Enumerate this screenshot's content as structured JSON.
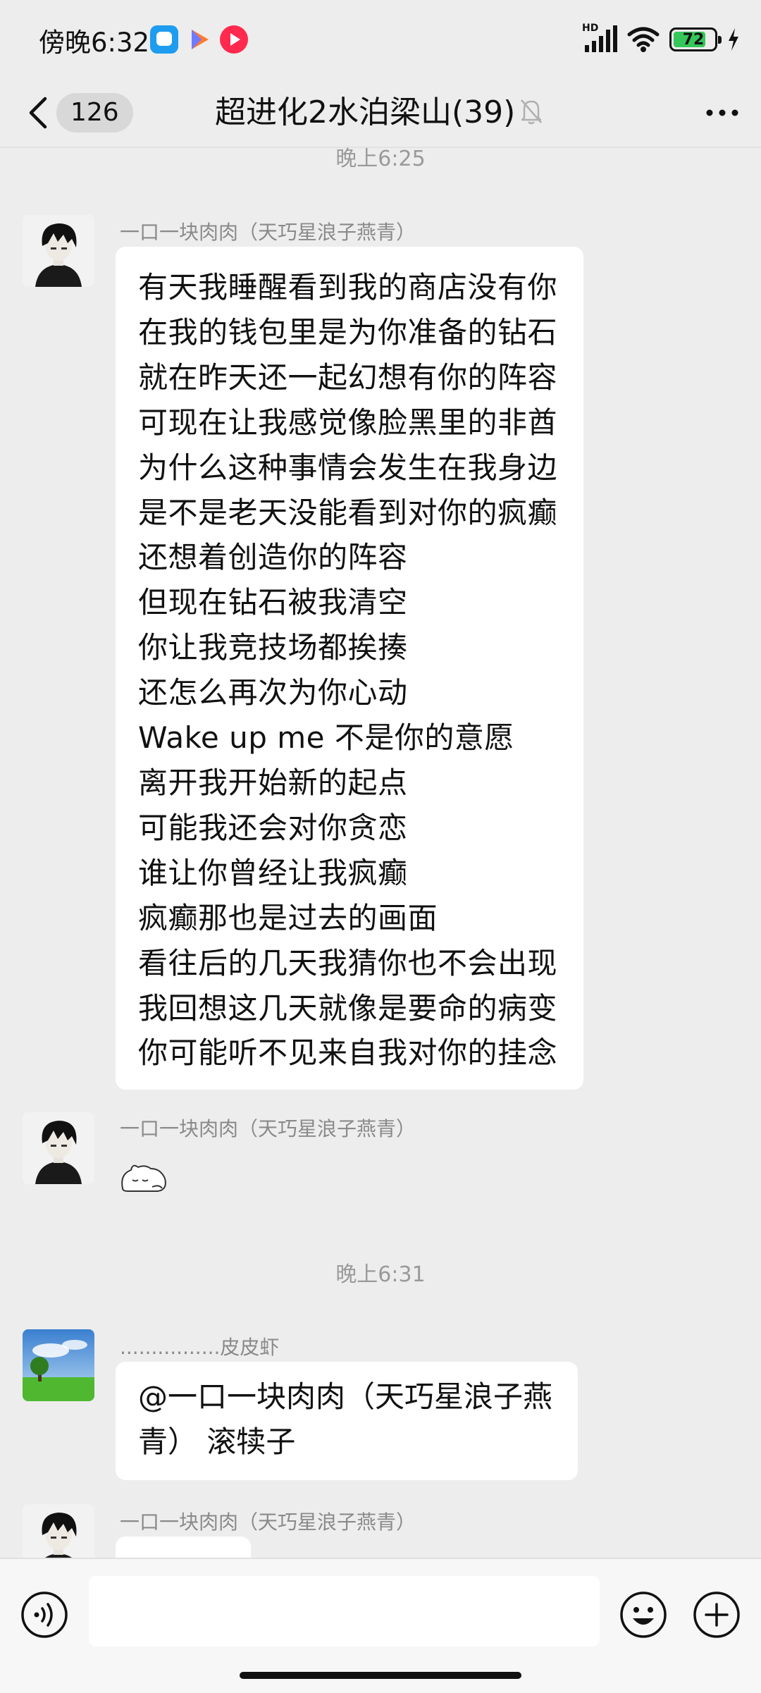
{
  "status_bar": {
    "time": "傍晚6:32",
    "network_label": "HD",
    "battery_level": "72",
    "app_icons": [
      "message-app-icon",
      "video-player-icon",
      "music-app-icon"
    ]
  },
  "header": {
    "unread_count": "126",
    "title": "超进化2水泊梁山(39)",
    "muted": true
  },
  "messages": [
    {
      "type": "timestamp",
      "text": "晚上6:25"
    },
    {
      "type": "text",
      "sender": "一口一块肉肉（天巧星浪子燕青）",
      "avatar": "dark-haired-anime-avatar",
      "lines": [
        "有天我睡醒看到我的商店没有你",
        "在我的钱包里是为你准备的钻石",
        "就在昨天还一起幻想有你的阵容",
        "可现在让我感觉像脸黑里的非酋",
        "为什么这种事情会发生在我身边",
        "是不是老天没能看到对你的疯癫",
        "还想着创造你的阵容",
        "但现在钻石被我清空",
        "你让我竞技场都挨揍",
        "还怎么再次为你心动",
        "Wake up me 不是你的意愿",
        "离开我开始新的起点",
        "可能我还会对你贪恋",
        "谁让你曾经让我疯癫",
        "疯癫那也是过去的画面",
        "看往后的几天我猜你也不会出现",
        "我回想这几天就像是要命的病变",
        "你可能听不见来自我对你的挂念"
      ]
    },
    {
      "type": "sticker",
      "sender": "一口一块肉肉（天巧星浪子燕青）",
      "avatar": "dark-haired-anime-avatar",
      "sticker": "sleeping-cat-sticker"
    },
    {
      "type": "timestamp",
      "text": "晚上6:31"
    },
    {
      "type": "text",
      "sender": "................皮皮虾",
      "avatar": "tree-landscape-avatar",
      "lines": [
        "@一口一块肉肉（天巧星浪子燕",
        "青） 滚犊子"
      ]
    },
    {
      "type": "partial",
      "sender": "一口一块肉肉（天巧星浪子燕青）",
      "avatar": "dark-haired-anime-avatar"
    }
  ],
  "input_bar": {
    "placeholder": "",
    "icons": [
      "voice-icon",
      "emoji-icon",
      "plus-icon"
    ]
  },
  "colors": {
    "background": "#ededed",
    "bubble": "#ffffff",
    "battery_fill": "#35c759",
    "secondary_text": "#8a8a8a"
  }
}
